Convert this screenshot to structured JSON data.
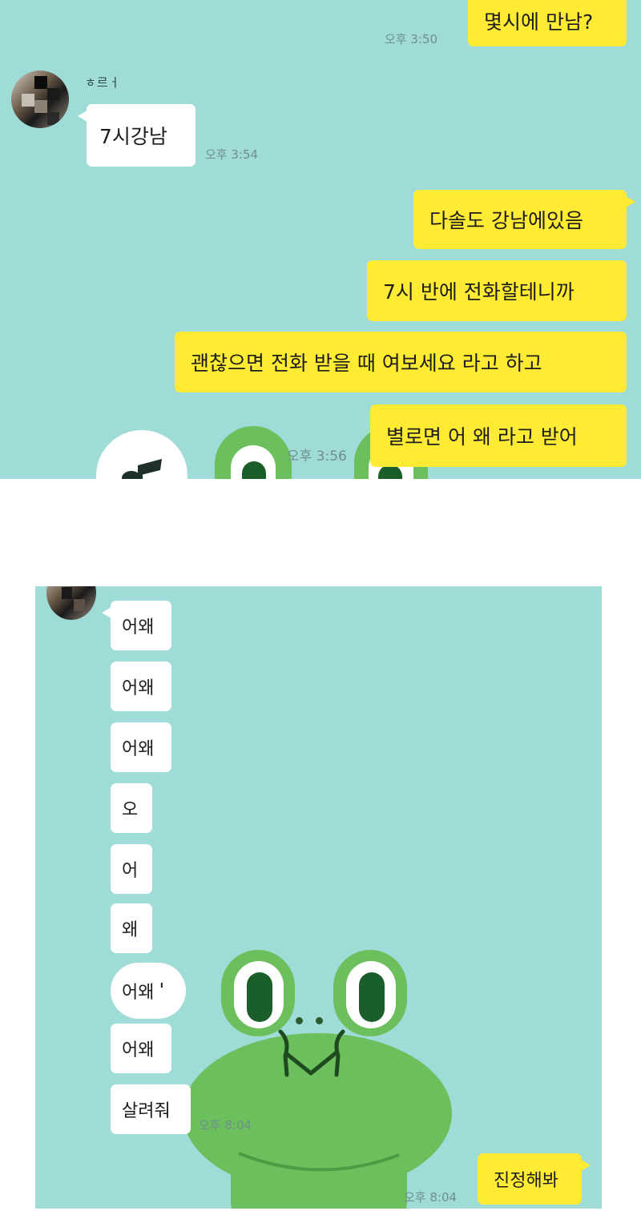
{
  "panel1": {
    "messages_me": [
      {
        "text": "몇시에 만남?",
        "time": "오후 3:50"
      },
      {
        "text": "다솔도 강남에있음"
      },
      {
        "text": "7시 반에 전화할테니까"
      },
      {
        "text": "괜찮으면 전화 받을 때 여보세요 라고 하고"
      },
      {
        "text": "별로면 어 왜 라고 받어",
        "time": "오후 3:56"
      }
    ],
    "sender_name": "ㅎ르ㅓ",
    "message_them": {
      "text": "7시강남",
      "time": "오후 3:54"
    }
  },
  "panel2": {
    "messages_them": [
      {
        "text": "어왜"
      },
      {
        "text": "어왜"
      },
      {
        "text": "어왜"
      },
      {
        "text": "오"
      },
      {
        "text": "어"
      },
      {
        "text": "왜"
      },
      {
        "text": "어왜"
      },
      {
        "text": "어왜"
      },
      {
        "text": "살려줘",
        "time": "오후 8:04"
      }
    ],
    "message_me": {
      "text": "진정해봐",
      "time": "오후 8:04"
    }
  },
  "colors": {
    "chat_background": "#9fdbd7",
    "my_bubble": "#ffeb33",
    "their_bubble": "#ffffff",
    "frog_green": "#6cbf5d"
  },
  "icons": [
    "music-note-icon",
    "frog-sticker"
  ]
}
